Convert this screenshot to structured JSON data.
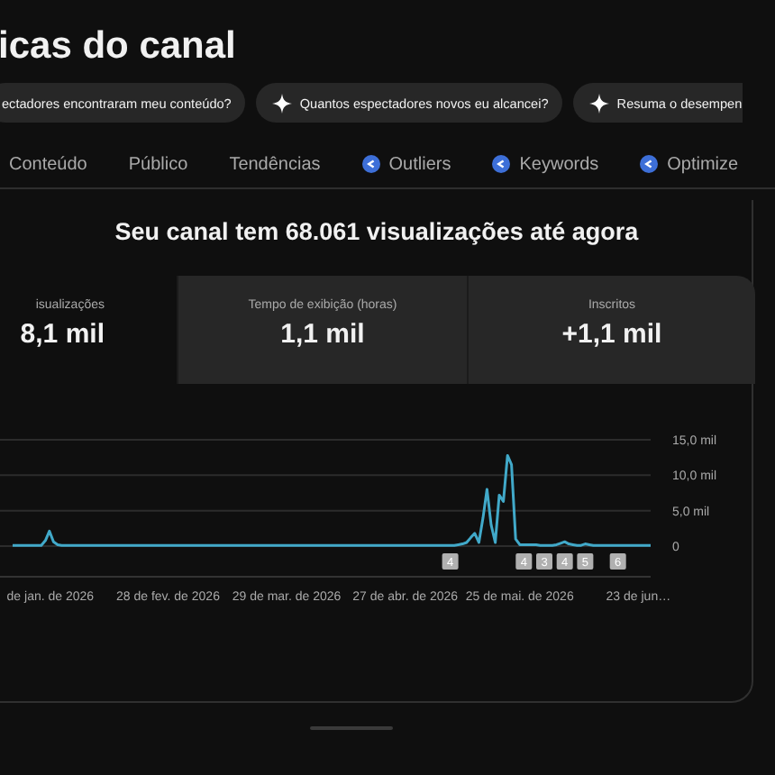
{
  "page_title": "icas do canal",
  "suggestion_chips": [
    {
      "label": "ectadores encontraram meu conteúdo?",
      "icon": false
    },
    {
      "label": "Quantos espectadores novos eu alcancei?",
      "icon": true
    },
    {
      "label": "Resuma o desempen",
      "icon": true
    }
  ],
  "tabs": [
    {
      "label": "Conteúdo",
      "kind": "plain"
    },
    {
      "label": "Público",
      "kind": "plain"
    },
    {
      "label": "Tendências",
      "kind": "plain"
    },
    {
      "label": "Outliers",
      "kind": "extension"
    },
    {
      "label": "Keywords",
      "kind": "extension"
    },
    {
      "label": "Optimize",
      "kind": "extension"
    }
  ],
  "summary": {
    "heading": "Seu canal tem 68.061 visualizações até agora",
    "metrics": [
      {
        "label": "isualizações",
        "value": "8,1 mil",
        "selected": true
      },
      {
        "label": "Tempo de exibição (horas)",
        "value": "1,1 mil",
        "selected": false
      },
      {
        "label": "Inscritos",
        "value": "+1,1 mil",
        "selected": false
      }
    ],
    "chart_data": {
      "type": "line",
      "categories": [
        null,
        null,
        null,
        null,
        null,
        null,
        null,
        null,
        null,
        "de jan. de 2026",
        null,
        null,
        null,
        null,
        null,
        null,
        null,
        null,
        null,
        null,
        null,
        null,
        null,
        null,
        null,
        null,
        null,
        null,
        null,
        null,
        null,
        null,
        null,
        null,
        null,
        null,
        null,
        null,
        "28 de fev. de 2026",
        null,
        null,
        null,
        null,
        null,
        null,
        null,
        null,
        null,
        null,
        null,
        null,
        null,
        null,
        null,
        null,
        null,
        null,
        null,
        null,
        null,
        null,
        null,
        null,
        null,
        null,
        null,
        null,
        "29 de mar. de 2026",
        null,
        null,
        null,
        null,
        null,
        null,
        null,
        null,
        null,
        null,
        null,
        null,
        null,
        null,
        null,
        null,
        null,
        null,
        null,
        null,
        null,
        null,
        null,
        null,
        null,
        null,
        null,
        null,
        "27 de abr. de 2026",
        null,
        null,
        null,
        null,
        null,
        null,
        null,
        null,
        null,
        null,
        null,
        null,
        null,
        null,
        null,
        null,
        null,
        null,
        null,
        null,
        null,
        null,
        null,
        null,
        null,
        null,
        null,
        "25 de mai. de 2026",
        null,
        null,
        null,
        null,
        null,
        null,
        null,
        null,
        null,
        null,
        null,
        null,
        null,
        null,
        null,
        null,
        null,
        null,
        null,
        null,
        null,
        null,
        null,
        null,
        null,
        null,
        null,
        null,
        "23 de jun…",
        null,
        null,
        null
      ],
      "series": [
        {
          "color": "#41a9c9",
          "values": [
            0.1,
            0.1,
            0.1,
            0.1,
            0.1,
            0.1,
            0.1,
            0.1,
            0.8,
            2.1,
            0.6,
            0.2,
            0.1,
            0.1,
            0.1,
            0.1,
            0.1,
            0.1,
            0.1,
            0.1,
            0.1,
            0.1,
            0.1,
            0.1,
            0.1,
            0.1,
            0.1,
            0.1,
            0.1,
            0.1,
            0.1,
            0.1,
            0.1,
            0.1,
            0.1,
            0.1,
            0.1,
            0.1,
            0.1,
            0.1,
            0.1,
            0.1,
            0.1,
            0.1,
            0.1,
            0.1,
            0.1,
            0.1,
            0.1,
            0.1,
            0.1,
            0.1,
            0.1,
            0.1,
            0.1,
            0.1,
            0.1,
            0.1,
            0.1,
            0.1,
            0.1,
            0.1,
            0.1,
            0.1,
            0.1,
            0.1,
            0.1,
            0.1,
            0.1,
            0.1,
            0.1,
            0.1,
            0.1,
            0.1,
            0.1,
            0.1,
            0.1,
            0.1,
            0.1,
            0.1,
            0.1,
            0.1,
            0.1,
            0.1,
            0.1,
            0.1,
            0.1,
            0.1,
            0.1,
            0.1,
            0.1,
            0.1,
            0.1,
            0.1,
            0.1,
            0.1,
            0.1,
            0.1,
            0.1,
            0.1,
            0.1,
            0.1,
            0.1,
            0.1,
            0.1,
            0.1,
            0.1,
            0.1,
            0.1,
            0.2,
            0.3,
            0.5,
            1.2,
            1.8,
            0.5,
            4,
            8,
            3,
            0.5,
            7.2,
            6.3,
            12.8,
            11.5,
            1,
            0.2,
            0.2,
            0.2,
            0.2,
            0.2,
            0.1,
            0.1,
            0.1,
            0.1,
            0.2,
            0.4,
            0.6,
            0.3,
            0.2,
            0.1,
            0.1,
            0.3,
            0.2,
            0.1,
            0.1,
            0.1,
            0.1,
            0.1,
            0.1,
            0.1,
            0.1,
            0.1,
            0.1,
            0.1,
            0.1,
            0.1,
            0.1,
            0.1
          ]
        }
      ],
      "ylim": [
        0,
        15
      ],
      "yticks": [
        {
          "value": 0,
          "label": "0"
        },
        {
          "value": 5,
          "label": "5,0 mil"
        },
        {
          "value": 10,
          "label": "10,0 mil"
        },
        {
          "value": 15,
          "label": "15,0 mil"
        }
      ]
    },
    "chart_markers": [
      {
        "label": "4"
      },
      {
        "label": "4"
      },
      {
        "label": "3"
      },
      {
        "label": "4"
      },
      {
        "label": "5"
      },
      {
        "label": "6"
      }
    ]
  }
}
